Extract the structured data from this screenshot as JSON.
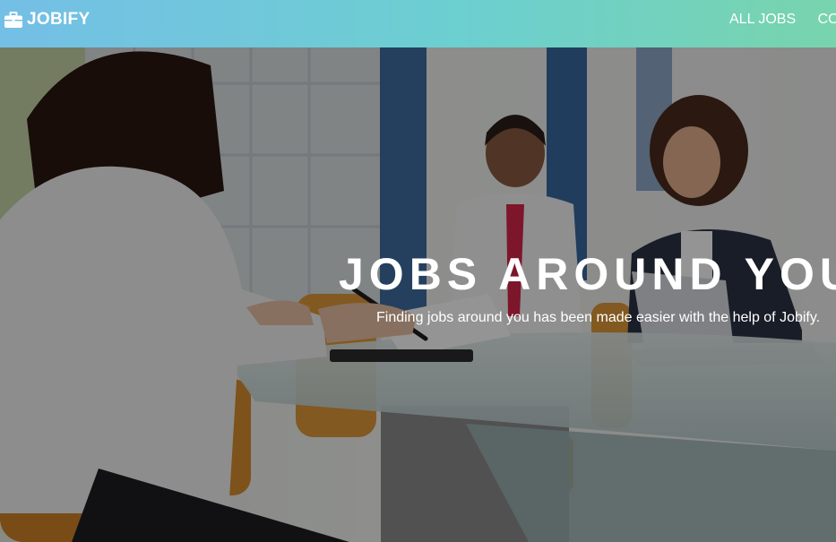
{
  "brand": {
    "name": "JOBIFY",
    "icon": "briefcase-icon"
  },
  "nav": {
    "items": [
      {
        "label": "ALL JOBS"
      },
      {
        "label": "CONTACT"
      }
    ]
  },
  "hero": {
    "title": "JOBS AROUND YOU",
    "subtitle": "Finding jobs around you has been made easier with the help of Jobify.",
    "image": "office-meeting-photo"
  },
  "colors": {
    "navbar_gradient": [
      "#74bfe6",
      "#78d4ad"
    ],
    "text": "#ffffff"
  }
}
